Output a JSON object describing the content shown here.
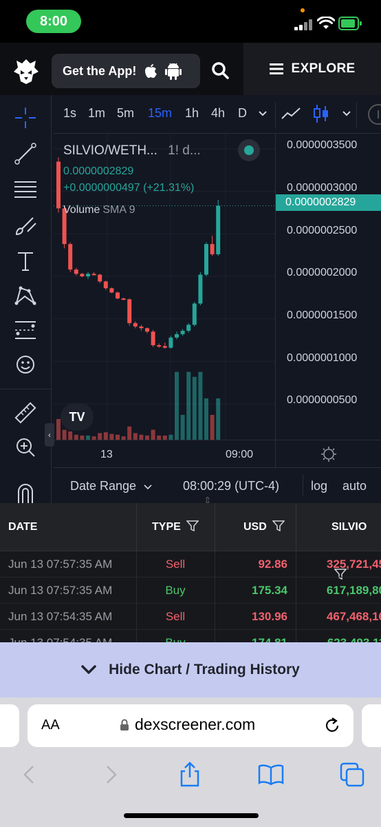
{
  "status_bar": {
    "time": "8:00"
  },
  "header": {
    "get_app_label": "Get the App!",
    "explore_label": "EXPLORE"
  },
  "chart": {
    "timeframes": [
      "1s",
      "1m",
      "5m",
      "15m",
      "1h",
      "4h",
      "D"
    ],
    "active_timeframe": "15m",
    "pair_title": "SILVIO/WETH...",
    "pair_suffix": "1! d...",
    "last_price": "0.0000002829",
    "change": "+0.0000000497 (+21.31%)",
    "volume_label": "Volume",
    "volume_indicator": "SMA 9",
    "price_ticks": [
      "0.0000003500",
      "0.0000003000",
      "0.0000002500",
      "0.0000002000",
      "0.0000001500",
      "0.0000001000",
      "0.0000000500"
    ],
    "current_price_label": "0.0000002829",
    "time_ticks": [
      "13",
      "09:00"
    ],
    "tv_logo": "TV",
    "date_range_label": "Date Range",
    "clock": "08:00:29 (UTC-4)",
    "log_label": "log",
    "auto_label": "auto",
    "up_color": "#26a69a",
    "down_color": "#ef5350"
  },
  "chart_data": {
    "type": "candlestick",
    "ylim": [
      0.0,
      3.6e-07
    ],
    "candles": [
      {
        "o": 3.35e-07,
        "h": 3.4e-07,
        "l": 2.75e-07,
        "c": 2.8e-07,
        "v": 0.25
      },
      {
        "o": 2.8e-07,
        "h": 2.83e-07,
        "l": 2.33e-07,
        "c": 2.38e-07,
        "v": 0.12
      },
      {
        "o": 2.38e-07,
        "h": 2.4e-07,
        "l": 2.05e-07,
        "c": 2.08e-07,
        "v": 0.1
      },
      {
        "o": 2.08e-07,
        "h": 2.1e-07,
        "l": 2.01e-07,
        "c": 2.03e-07,
        "v": 0.06
      },
      {
        "o": 2.03e-07,
        "h": 2.04e-07,
        "l": 1.99e-07,
        "c": 2e-07,
        "v": 0.05
      },
      {
        "o": 2e-07,
        "h": 2.05e-07,
        "l": 1.97e-07,
        "c": 2.03e-07,
        "v": 0.05
      },
      {
        "o": 2.03e-07,
        "h": 2.05e-07,
        "l": 2.01e-07,
        "c": 2.02e-07,
        "v": 0.04
      },
      {
        "o": 2.02e-07,
        "h": 2.03e-07,
        "l": 1.92e-07,
        "c": 1.94e-07,
        "v": 0.08
      },
      {
        "o": 1.94e-07,
        "h": 1.95e-07,
        "l": 1.84e-07,
        "c": 1.86e-07,
        "v": 0.09
      },
      {
        "o": 1.86e-07,
        "h": 1.87e-07,
        "l": 1.8e-07,
        "c": 1.81e-07,
        "v": 0.07
      },
      {
        "o": 1.81e-07,
        "h": 1.82e-07,
        "l": 1.73e-07,
        "c": 1.74e-07,
        "v": 0.06
      },
      {
        "o": 1.74e-07,
        "h": 1.75e-07,
        "l": 1.72e-07,
        "c": 1.73e-07,
        "v": 0.04
      },
      {
        "o": 1.73e-07,
        "h": 1.74e-07,
        "l": 1.42e-07,
        "c": 1.45e-07,
        "v": 0.16
      },
      {
        "o": 1.45e-07,
        "h": 1.47e-07,
        "l": 1.39e-07,
        "c": 1.41e-07,
        "v": 0.08
      },
      {
        "o": 1.41e-07,
        "h": 1.43e-07,
        "l": 1.36e-07,
        "c": 1.39e-07,
        "v": 0.06
      },
      {
        "o": 1.39e-07,
        "h": 1.4e-07,
        "l": 1.33e-07,
        "c": 1.35e-07,
        "v": 0.05
      },
      {
        "o": 1.35e-07,
        "h": 1.37e-07,
        "l": 1.17e-07,
        "c": 1.19e-07,
        "v": 0.12
      },
      {
        "o": 1.19e-07,
        "h": 1.21e-07,
        "l": 1.16e-07,
        "c": 1.18e-07,
        "v": 0.05
      },
      {
        "o": 1.18e-07,
        "h": 1.22e-07,
        "l": 1.15e-07,
        "c": 1.16e-07,
        "v": 0.05
      },
      {
        "o": 1.16e-07,
        "h": 1.3e-07,
        "l": 1.15e-07,
        "c": 1.28e-07,
        "v": 0.06
      },
      {
        "o": 1.28e-07,
        "h": 1.35e-07,
        "l": 1.26e-07,
        "c": 1.32e-07,
        "v": 0.82
      },
      {
        "o": 1.32e-07,
        "h": 1.38e-07,
        "l": 1.3e-07,
        "c": 1.36e-07,
        "v": 0.3
      },
      {
        "o": 1.36e-07,
        "h": 1.45e-07,
        "l": 1.34e-07,
        "c": 1.43e-07,
        "v": 0.82
      },
      {
        "o": 1.43e-07,
        "h": 1.7e-07,
        "l": 1.41e-07,
        "c": 1.68e-07,
        "v": 0.76
      },
      {
        "o": 1.68e-07,
        "h": 2.05e-07,
        "l": 1.66e-07,
        "c": 2.02e-07,
        "v": 0.82
      },
      {
        "o": 2.02e-07,
        "h": 2.4e-07,
        "l": 2e-07,
        "c": 2.38e-07,
        "v": 0.5
      },
      {
        "o": 2.38e-07,
        "h": 2.48e-07,
        "l": 2.24e-07,
        "c": 2.26e-07,
        "v": 0.3
      },
      {
        "o": 2.26e-07,
        "h": 2.9e-07,
        "l": 2.24e-07,
        "c": 2.83e-07,
        "v": 0.5
      }
    ]
  },
  "table": {
    "headers": [
      "DATE",
      "TYPE",
      "USD",
      "SILVIO"
    ],
    "rows": [
      {
        "date": "Jun 13 07:57:35 AM",
        "type": "Sell",
        "usd": "92.86",
        "tokens": "325,721,45"
      },
      {
        "date": "Jun 13 07:57:35 AM",
        "type": "Buy",
        "usd": "175.34",
        "tokens": "617,189,80"
      },
      {
        "date": "Jun 13 07:54:35 AM",
        "type": "Sell",
        "usd": "130.96",
        "tokens": "467,468,16"
      },
      {
        "date": "Jun 13 07:54:35 AM",
        "type": "Buy",
        "usd": "174.81",
        "tokens": "623,493,11"
      }
    ]
  },
  "hide_bar": {
    "label": "Hide Chart / Trading History"
  },
  "browser": {
    "aa_label": "AA",
    "url": "dexscreener.com"
  }
}
